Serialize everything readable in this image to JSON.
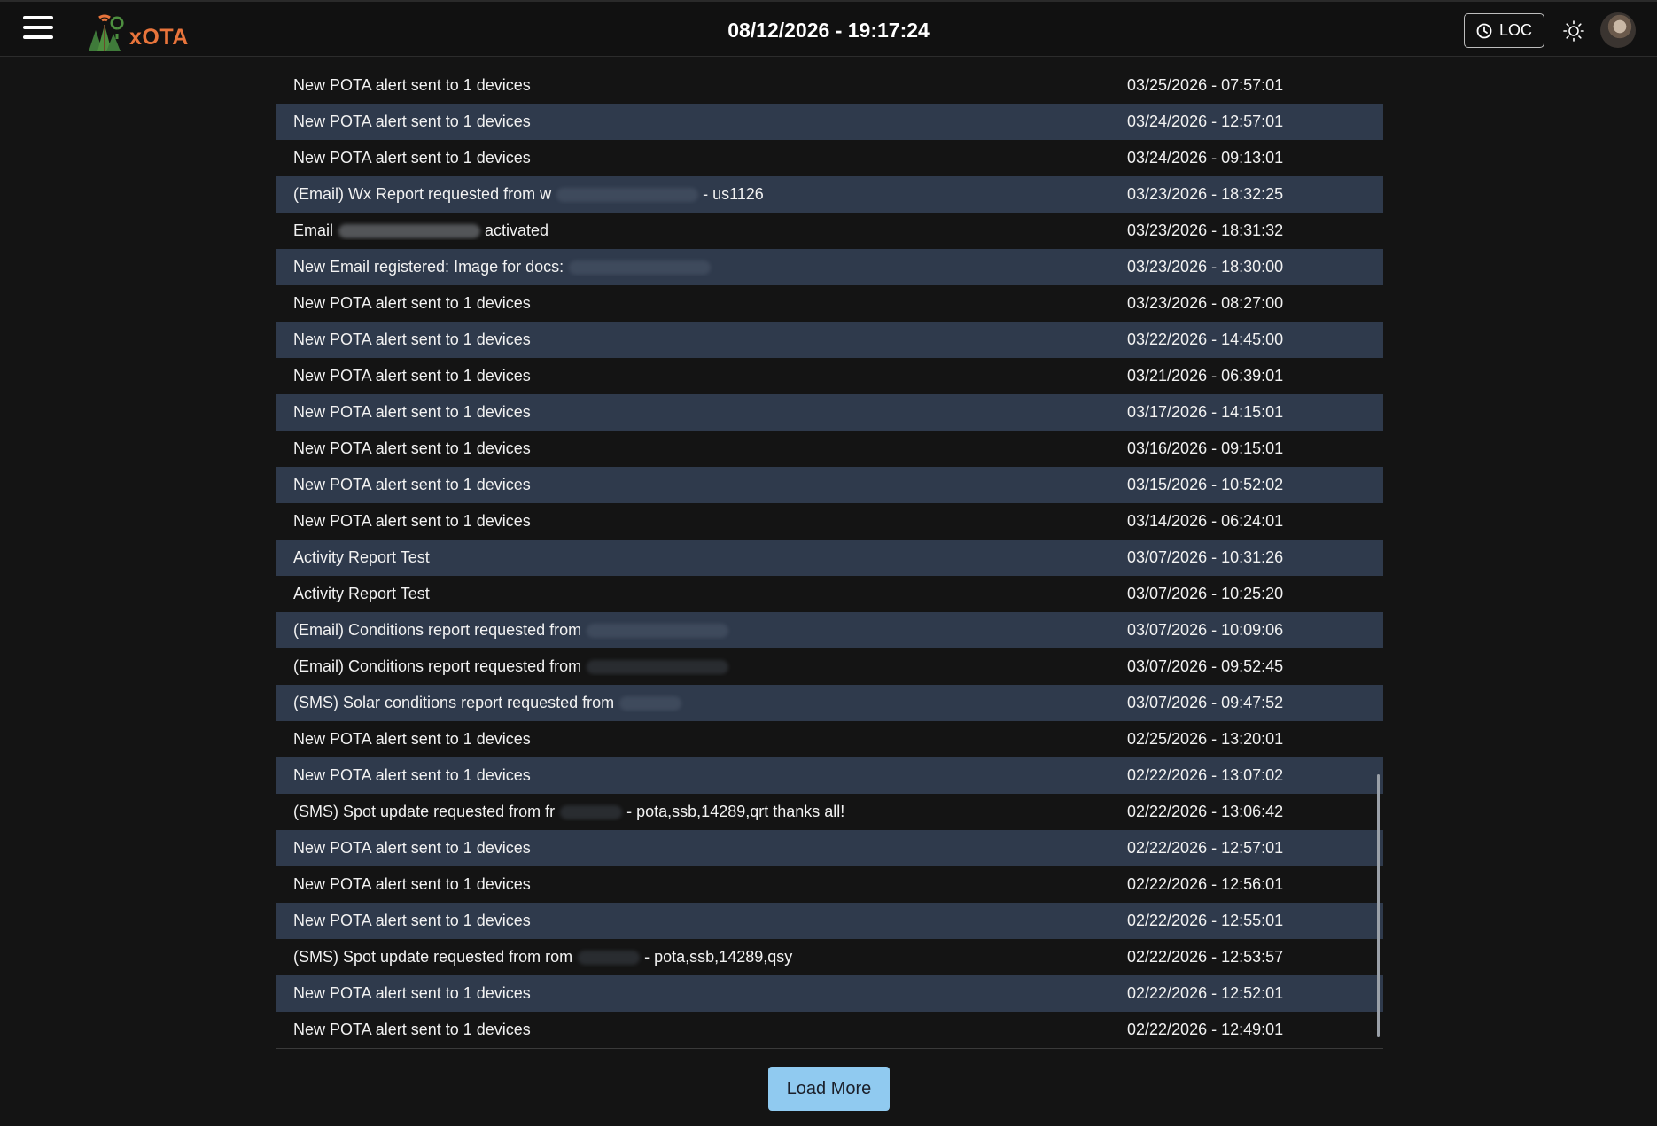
{
  "header": {
    "logo_text": "xOTA",
    "datetime": "08/12/2026 - 19:17:24",
    "loc_label": "LOC",
    "icons": {
      "menu": "hamburger-menu-icon",
      "clock": "clock-icon",
      "theme": "sun-icon"
    }
  },
  "activity": {
    "rows": [
      {
        "message": "New POTA alert sent to 1 devices",
        "redact": "",
        "suffix": "",
        "timestamp": "03/25/2026 - 07:57:01"
      },
      {
        "message": "New POTA alert sent to 1 devices",
        "redact": "",
        "suffix": "",
        "timestamp": "03/24/2026 - 12:57:01"
      },
      {
        "message": "New POTA alert sent to 1 devices",
        "redact": "",
        "suffix": "",
        "timestamp": "03/24/2026 - 09:13:01"
      },
      {
        "message": "(Email) Wx Report requested from w",
        "redact": "long",
        "suffix": " - us1126",
        "timestamp": "03/23/2026 - 18:32:25"
      },
      {
        "message": "Email",
        "redact": "medium",
        "suffix": " activated",
        "timestamp": "03/23/2026 - 18:31:32"
      },
      {
        "message": "New Email registered: Image for docs:",
        "redact": "long",
        "suffix": "",
        "timestamp": "03/23/2026 - 18:30:00"
      },
      {
        "message": "New POTA alert sent to 1 devices",
        "redact": "",
        "suffix": "",
        "timestamp": "03/23/2026 - 08:27:00"
      },
      {
        "message": "New POTA alert sent to 1 devices",
        "redact": "",
        "suffix": "",
        "timestamp": "03/22/2026 - 14:45:00"
      },
      {
        "message": "New POTA alert sent to 1 devices",
        "redact": "",
        "suffix": "",
        "timestamp": "03/21/2026 - 06:39:01"
      },
      {
        "message": "New POTA alert sent to 1 devices",
        "redact": "",
        "suffix": "",
        "timestamp": "03/17/2026 - 14:15:01"
      },
      {
        "message": "New POTA alert sent to 1 devices",
        "redact": "",
        "suffix": "",
        "timestamp": "03/16/2026 - 09:15:01"
      },
      {
        "message": "New POTA alert sent to 1 devices",
        "redact": "",
        "suffix": "",
        "timestamp": "03/15/2026 - 10:52:02"
      },
      {
        "message": "New POTA alert sent to 1 devices",
        "redact": "",
        "suffix": "",
        "timestamp": "03/14/2026 - 06:24:01"
      },
      {
        "message": "Activity Report Test",
        "redact": "",
        "suffix": "",
        "timestamp": "03/07/2026 - 10:31:26"
      },
      {
        "message": "Activity Report Test",
        "redact": "",
        "suffix": "",
        "timestamp": "03/07/2026 - 10:25:20"
      },
      {
        "message": "(Email) Conditions report requested from",
        "redact": "long",
        "suffix": "",
        "timestamp": "03/07/2026 - 10:09:06"
      },
      {
        "message": "(Email) Conditions report requested from",
        "redact": "long",
        "suffix": "",
        "timestamp": "03/07/2026 - 09:52:45"
      },
      {
        "message": "(SMS) Solar conditions report requested from",
        "redact": "short",
        "suffix": "",
        "timestamp": "03/07/2026 - 09:47:52"
      },
      {
        "message": "New POTA alert sent to 1 devices",
        "redact": "",
        "suffix": "",
        "timestamp": "02/25/2026 - 13:20:01"
      },
      {
        "message": "New POTA alert sent to 1 devices",
        "redact": "",
        "suffix": "",
        "timestamp": "02/22/2026 - 13:07:02"
      },
      {
        "message": "(SMS) Spot update requested from fr",
        "redact": "short",
        "suffix": " - pota,ssb,14289,qrt thanks all!",
        "timestamp": "02/22/2026 - 13:06:42"
      },
      {
        "message": "New POTA alert sent to 1 devices",
        "redact": "",
        "suffix": "",
        "timestamp": "02/22/2026 - 12:57:01"
      },
      {
        "message": "New POTA alert sent to 1 devices",
        "redact": "",
        "suffix": "",
        "timestamp": "02/22/2026 - 12:56:01"
      },
      {
        "message": "New POTA alert sent to 1 devices",
        "redact": "",
        "suffix": "",
        "timestamp": "02/22/2026 - 12:55:01"
      },
      {
        "message": "(SMS) Spot update requested from rom",
        "redact": "short",
        "suffix": " - pota,ssb,14289,qsy",
        "timestamp": "02/22/2026 - 12:53:57"
      },
      {
        "message": "New POTA alert sent to 1 devices",
        "redact": "",
        "suffix": "",
        "timestamp": "02/22/2026 - 12:52:01"
      },
      {
        "message": "New POTA alert sent to 1 devices",
        "redact": "",
        "suffix": "",
        "timestamp": "02/22/2026 - 12:49:01"
      }
    ]
  },
  "footer": {
    "load_more_label": "Load More"
  },
  "colors": {
    "background": "#141414",
    "row_alt": "#2f3a4c",
    "accent_orange": "#e8743b",
    "button_blue": "#90caf0"
  }
}
